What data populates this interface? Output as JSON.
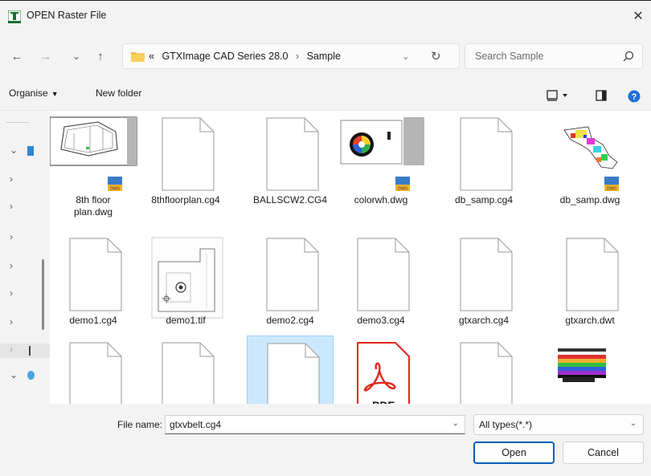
{
  "window": {
    "title": "OPEN Raster File",
    "close_glyph": "✕"
  },
  "nav": {
    "back": "←",
    "forward": "→",
    "recent": "⌄",
    "up": "↑",
    "breadcrumb_prefix": "«",
    "breadcrumb": [
      "GTXImage CAD Series 28.0",
      "Sample"
    ],
    "breadcrumb_sep": "›",
    "address_dropdown": "⌄",
    "refresh": "↻",
    "search_placeholder": "Search Sample"
  },
  "toolbar": {
    "organise": "Organise",
    "organise_caret": "▼",
    "new_folder": "New folder"
  },
  "navpane": {
    "chevrons": [
      "⌄",
      "›",
      "›",
      "›",
      "›",
      "›",
      "›",
      "›",
      "⌄"
    ]
  },
  "files": [
    {
      "name": "8th floor plan.dwg",
      "line1": "8th floor",
      "line2": "plan.dwg",
      "kind": "dwg-floorplan"
    },
    {
      "name": "8thfloorplan.cg4",
      "line1": "8thfloorplan.cg4",
      "line2": "",
      "kind": "blank"
    },
    {
      "name": "BALLSCW2.CG4",
      "line1": "BALLSCW2.CG4",
      "line2": "",
      "kind": "blank"
    },
    {
      "name": "colorwh.dwg",
      "line1": "colorwh.dwg",
      "line2": "",
      "kind": "dwg-colorwheel"
    },
    {
      "name": "db_samp.cg4",
      "line1": "db_samp.cg4",
      "line2": "",
      "kind": "blank"
    },
    {
      "name": "db_samp.dwg",
      "line1": "db_samp.dwg",
      "line2": "",
      "kind": "dwg-map"
    },
    {
      "name": "demo1.cg4",
      "line1": "demo1.cg4",
      "line2": "",
      "kind": "blank"
    },
    {
      "name": "demo1.tif",
      "line1": "demo1.tif",
      "line2": "",
      "kind": "tif-scan"
    },
    {
      "name": "demo2.cg4",
      "line1": "demo2.cg4",
      "line2": "",
      "kind": "blank"
    },
    {
      "name": "demo3.cg4",
      "line1": "demo3.cg4",
      "line2": "",
      "kind": "blank"
    },
    {
      "name": "gtxarch.cg4",
      "line1": "gtxarch.cg4",
      "line2": "",
      "kind": "blank"
    },
    {
      "name": "gtxarch.dwt",
      "line1": "gtxarch.dwt",
      "line2": "",
      "kind": "blank"
    },
    {
      "name": "",
      "line1": "",
      "line2": "",
      "kind": "blank"
    },
    {
      "name": "",
      "line1": "",
      "line2": "",
      "kind": "blank"
    },
    {
      "name": "",
      "line1": "",
      "line2": "",
      "kind": "blank",
      "selected": true
    },
    {
      "name": "",
      "line1": "",
      "line2": "",
      "kind": "pdf",
      "pdf_label": "PDF"
    },
    {
      "name": "",
      "line1": "",
      "line2": "",
      "kind": "blank"
    },
    {
      "name": "",
      "line1": "",
      "line2": "",
      "kind": "dwg-spectrum"
    }
  ],
  "dwg_badge": "DWG",
  "footer": {
    "file_name_label": "File name:",
    "file_name_value": "gtxvbelt.cg4",
    "dropdown_glyph": "⌄",
    "file_type": "All types(*.*)",
    "open_label": "Open",
    "cancel_label": "Cancel"
  },
  "colors": {
    "accent": "#005fb8",
    "selection": "#cce8ff",
    "folder": "#f4c142",
    "pdf_red": "#e1251b"
  }
}
